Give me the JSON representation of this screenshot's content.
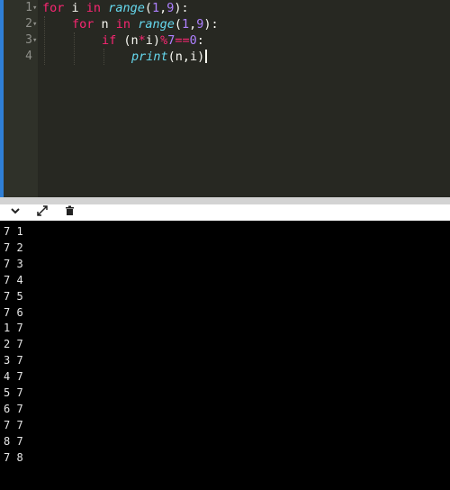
{
  "editor": {
    "line_numbers": [
      "1",
      "2",
      "3",
      "4"
    ],
    "lines": [
      [
        {
          "t": "for",
          "c": "kw"
        },
        {
          "t": " i "
        },
        {
          "t": "in",
          "c": "kw"
        },
        {
          "t": " "
        },
        {
          "t": "range",
          "c": "fn"
        },
        {
          "t": "("
        },
        {
          "t": "1",
          "c": "num"
        },
        {
          "t": ","
        },
        {
          "t": "9",
          "c": "num"
        },
        {
          "t": "):"
        }
      ],
      [
        {
          "t": "for",
          "c": "kw"
        },
        {
          "t": " n "
        },
        {
          "t": "in",
          "c": "kw"
        },
        {
          "t": " "
        },
        {
          "t": "range",
          "c": "fn"
        },
        {
          "t": "("
        },
        {
          "t": "1",
          "c": "num"
        },
        {
          "t": ","
        },
        {
          "t": "9",
          "c": "num"
        },
        {
          "t": "):"
        }
      ],
      [
        {
          "t": "if",
          "c": "kw"
        },
        {
          "t": " (n"
        },
        {
          "t": "*",
          "c": "kw"
        },
        {
          "t": "i)"
        },
        {
          "t": "%",
          "c": "kw"
        },
        {
          "t": "7",
          "c": "num"
        },
        {
          "t": "==",
          "c": "kw"
        },
        {
          "t": "0",
          "c": "num"
        },
        {
          "t": ":"
        }
      ],
      [
        {
          "t": "print",
          "c": "fn"
        },
        {
          "t": "(n,i)"
        }
      ]
    ]
  },
  "toolbar": {
    "collapse_icon": "chevron-down-icon",
    "expand_icon": "expand-arrows-icon",
    "clear_icon": "clear-console-icon"
  },
  "console": {
    "output": [
      "7 1",
      "7 2",
      "7 3",
      "7 4",
      "7 5",
      "7 6",
      "1 7",
      "2 7",
      "3 7",
      "4 7",
      "5 7",
      "6 7",
      "7 7",
      "8 7",
      "7 8"
    ]
  },
  "colors": {
    "editor_bg": "#272822",
    "gutter_bg": "#2f3129",
    "keyword": "#f92672",
    "builtin": "#66d9ef",
    "number": "#ae81ff",
    "console_bg": "#000000"
  }
}
